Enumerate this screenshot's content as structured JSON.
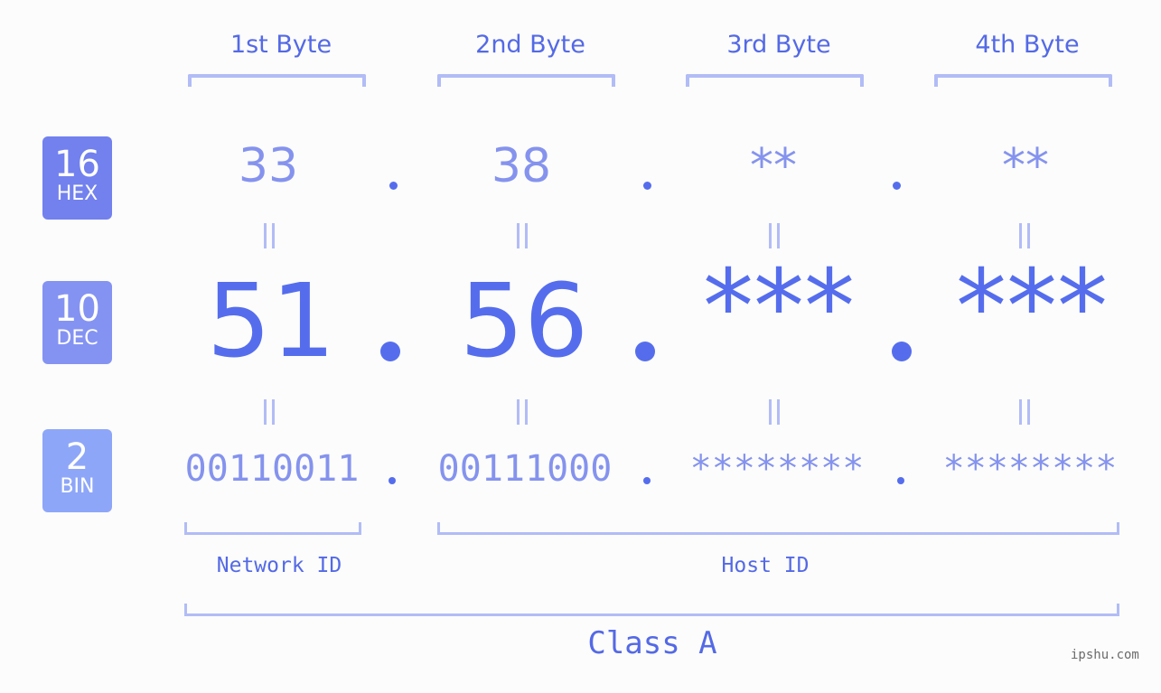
{
  "byte_headers": [
    "1st Byte",
    "2nd Byte",
    "3rd Byte",
    "4th Byte"
  ],
  "badges": [
    {
      "base": "16",
      "label": "HEX",
      "color": "#7281ee"
    },
    {
      "base": "10",
      "label": "DEC",
      "color": "#8493f2"
    },
    {
      "base": "2",
      "label": "BIN",
      "color": "#8ea6f8"
    }
  ],
  "hex": [
    "33",
    "38",
    "**",
    "**"
  ],
  "dec": [
    "51",
    "56",
    "***",
    "***"
  ],
  "bin": [
    "00110011",
    "00111000",
    "********",
    "********"
  ],
  "separator": ".",
  "equals_glyph": "=",
  "network_id_label": "Network ID",
  "host_id_label": "Host ID",
  "class_label": "Class A",
  "watermark": "ipshu.com",
  "colors": {
    "primary": "#556ded",
    "muted": "#8593ee",
    "bracket": "#b2bcf6"
  }
}
